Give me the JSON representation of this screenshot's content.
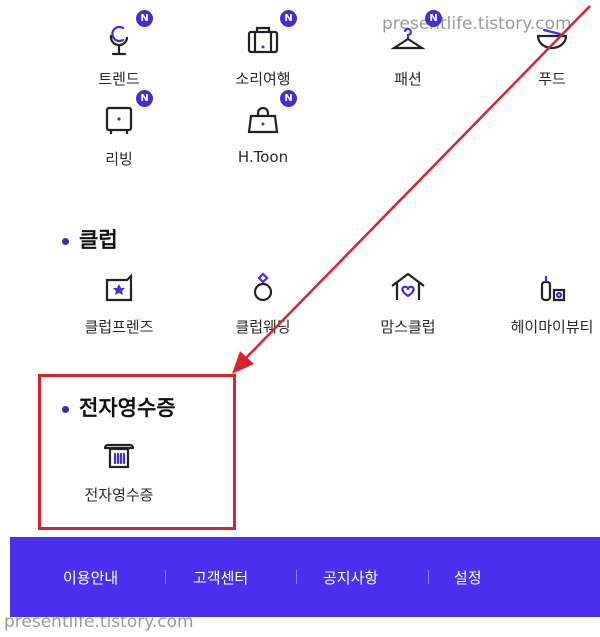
{
  "watermark_top": "presentlife.tistory.com",
  "watermark_bottom": "presentlife.tistory.com",
  "menu_grid": [
    {
      "label": "트렌드",
      "icon": "microphone-icon",
      "badge": "N"
    },
    {
      "label": "소리여행",
      "icon": "suitcase-icon",
      "badge": "N"
    },
    {
      "label": "패션",
      "icon": "hanger-icon",
      "badge": "N"
    },
    {
      "label": "푸드",
      "icon": "bowl-icon",
      "badge": ""
    },
    {
      "label": "리빙",
      "icon": "tv-icon",
      "badge": "N"
    },
    {
      "label": "H.Toon",
      "icon": "shopping-bag-icon",
      "badge": "N"
    }
  ],
  "club": {
    "title": "클럽",
    "items": [
      {
        "label": "클럽프렌즈",
        "icon": "star-card-icon"
      },
      {
        "label": "클럽웨딩",
        "icon": "ring-icon"
      },
      {
        "label": "맘스클럽",
        "icon": "house-heart-icon"
      },
      {
        "label": "헤이마이뷰티",
        "icon": "cosmetics-icon"
      }
    ]
  },
  "receipt": {
    "title": "전자영수증",
    "items": [
      {
        "label": "전자영수증",
        "icon": "receipt-printer-icon"
      }
    ]
  },
  "footer": {
    "links": [
      "이용안내",
      "고객센터",
      "공지사항",
      "설정"
    ]
  },
  "colors": {
    "accent": "#4a2fee",
    "badge": "#4a2bd8",
    "annotation_red": "#d8242f"
  }
}
